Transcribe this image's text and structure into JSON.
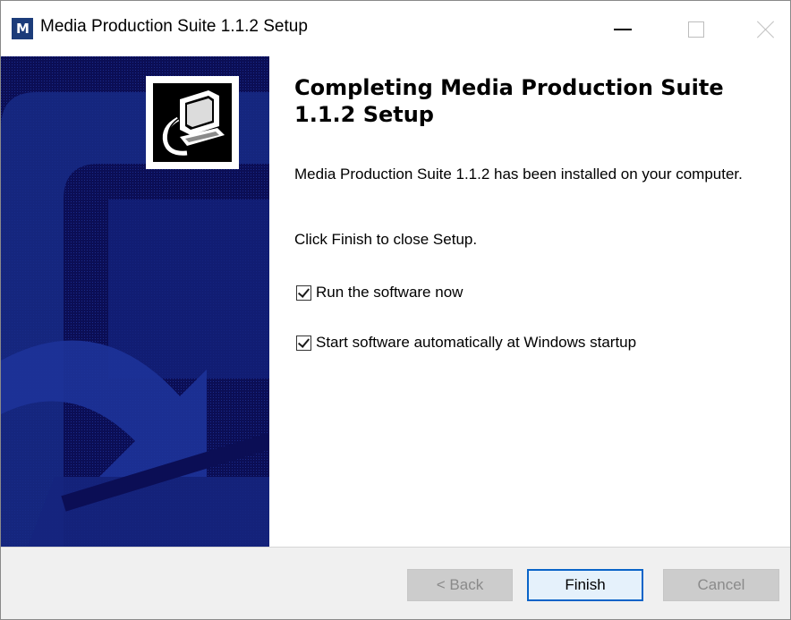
{
  "window": {
    "title": "Media Production Suite 1.1.2 Setup",
    "icon_letter": "M",
    "icon_name": "app-logo-icon",
    "controls": [
      "minimize-icon",
      "maximize-icon",
      "close-icon"
    ]
  },
  "banner": {
    "background_color": "#0b0e55",
    "logo_icon": "computer-install-icon"
  },
  "content": {
    "heading": "Completing Media Production Suite 1.1.2 Setup",
    "paragraph_1": "Media Production Suite 1.1.2 has been installed on your computer.",
    "paragraph_2": "Click Finish to close Setup.",
    "checkboxes": [
      {
        "label": "Run the software now",
        "checked": true
      },
      {
        "label": "Start software automatically at Windows startup",
        "checked": true
      }
    ]
  },
  "footer": {
    "back_label": "< Back",
    "finish_label": "Finish",
    "cancel_label": "Cancel",
    "back_enabled": false,
    "cancel_enabled": false,
    "accent_color": "#0a64c8"
  }
}
